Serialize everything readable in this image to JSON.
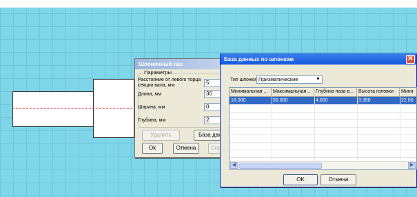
{
  "shponka_dialog": {
    "title": "Шпоночный паз",
    "group_label": "Параметры",
    "fields": [
      {
        "label": "Расстояние от левого торца секции вала, мм",
        "value": "5"
      },
      {
        "label": "Длина, мм",
        "value": "30"
      },
      {
        "label": "Ширина, мм",
        "value": "0"
      },
      {
        "label": "Глубина, мм",
        "value": "2"
      }
    ],
    "delete_label": "Удалить",
    "database_label": "База данных",
    "ok_label": "Ok",
    "cancel_label": "Отмена",
    "extra_label": "Спр"
  },
  "database_dialog": {
    "title": "База данных по шпонкам",
    "type_label": "Тип шпонки",
    "type_value": "Призматические",
    "columns": [
      "Минимальная ...",
      "Максимальная...",
      "Глубина паза в...",
      "Высота головки",
      "Мини"
    ],
    "rows": [
      [
        "18.000",
        "90.000",
        "4.000",
        "3.300",
        "22.00"
      ]
    ],
    "ok_label": "OK",
    "cancel_label": "Отмена"
  },
  "icons": {
    "close": "close-icon",
    "dropdown": "chevron-down-icon",
    "scroll_left": "arrow-left-icon",
    "scroll_right": "arrow-right-icon"
  },
  "colors": {
    "background": "#7fd6e8",
    "selection": "#316ac5",
    "active_title": "#1459d9",
    "centerline": "#dd3333"
  }
}
